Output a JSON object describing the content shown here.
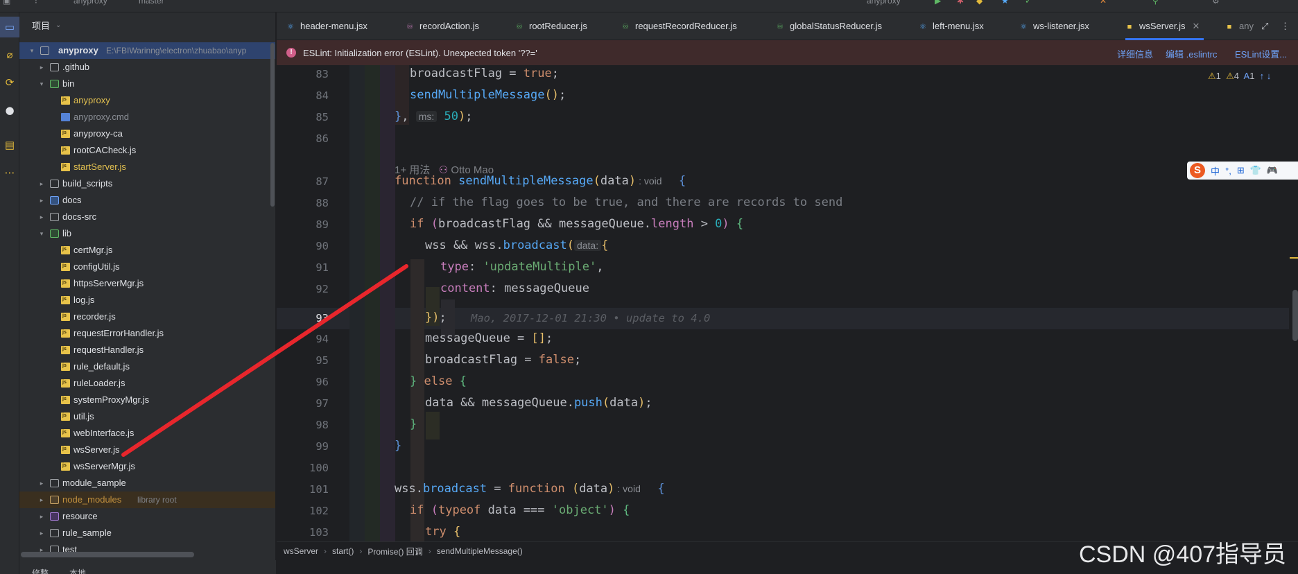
{
  "topbar": {
    "project": "anyproxy",
    "branch": "master",
    "run_config": "anyproxy"
  },
  "activity": {
    "items": [
      "project-icon",
      "commit-icon",
      "pull-requests-icon",
      "github-icon",
      "structure-icon",
      "more-icon"
    ]
  },
  "project_panel": {
    "title": "项目",
    "root": {
      "name": "anyproxy",
      "path": "E:\\FBIWarinng\\electron\\zhuabao\\anyp"
    },
    "tree": [
      {
        "name": ".github",
        "kind": "folder",
        "depth": 1,
        "expanded": false
      },
      {
        "name": "bin",
        "kind": "folder-green",
        "depth": 1,
        "expanded": true
      },
      {
        "name": "anyproxy",
        "kind": "js",
        "depth": 2,
        "color": "yellow"
      },
      {
        "name": "anyproxy.cmd",
        "kind": "cmd",
        "depth": 2,
        "color": "muted"
      },
      {
        "name": "anyproxy-ca",
        "kind": "js",
        "depth": 2
      },
      {
        "name": "rootCACheck.js",
        "kind": "js",
        "depth": 2
      },
      {
        "name": "startServer.js",
        "kind": "js",
        "depth": 2,
        "color": "yellow"
      },
      {
        "name": "build_scripts",
        "kind": "folder",
        "depth": 1,
        "expanded": false
      },
      {
        "name": "docs",
        "kind": "folder-blue",
        "depth": 1,
        "expanded": false
      },
      {
        "name": "docs-src",
        "kind": "folder",
        "depth": 1,
        "expanded": false
      },
      {
        "name": "lib",
        "kind": "folder-green",
        "depth": 1,
        "expanded": true
      },
      {
        "name": "certMgr.js",
        "kind": "js",
        "depth": 2
      },
      {
        "name": "configUtil.js",
        "kind": "js",
        "depth": 2
      },
      {
        "name": "httpsServerMgr.js",
        "kind": "js",
        "depth": 2
      },
      {
        "name": "log.js",
        "kind": "js",
        "depth": 2
      },
      {
        "name": "recorder.js",
        "kind": "js",
        "depth": 2
      },
      {
        "name": "requestErrorHandler.js",
        "kind": "js",
        "depth": 2
      },
      {
        "name": "requestHandler.js",
        "kind": "js",
        "depth": 2
      },
      {
        "name": "rule_default.js",
        "kind": "js",
        "depth": 2
      },
      {
        "name": "ruleLoader.js",
        "kind": "js",
        "depth": 2
      },
      {
        "name": "systemProxyMgr.js",
        "kind": "js",
        "depth": 2
      },
      {
        "name": "util.js",
        "kind": "js",
        "depth": 2
      },
      {
        "name": "webInterface.js",
        "kind": "js",
        "depth": 2
      },
      {
        "name": "wsServer.js",
        "kind": "js",
        "depth": 2
      },
      {
        "name": "wsServerMgr.js",
        "kind": "js",
        "depth": 2
      },
      {
        "name": "module_sample",
        "kind": "folder",
        "depth": 1,
        "expanded": false
      },
      {
        "name": "node_modules",
        "kind": "folder-orange",
        "depth": 1,
        "expanded": false,
        "color": "lib",
        "note": "library root"
      },
      {
        "name": "resource",
        "kind": "folder-purple",
        "depth": 1,
        "expanded": false
      },
      {
        "name": "rule_sample",
        "kind": "folder",
        "depth": 1,
        "expanded": false
      },
      {
        "name": "test",
        "kind": "folder",
        "depth": 1,
        "expanded": false
      }
    ],
    "bottom_tabs": [
      "修整",
      "本地"
    ]
  },
  "tabs": [
    {
      "label": "header-menu.jsx",
      "icon": "react-icon"
    },
    {
      "label": "recordAction.js",
      "icon": "redux-icon"
    },
    {
      "label": "rootReducer.js",
      "icon": "redux-icon"
    },
    {
      "label": "requestRecordReducer.js",
      "icon": "redux-icon"
    },
    {
      "label": "globalStatusReducer.js",
      "icon": "redux-icon"
    },
    {
      "label": "left-menu.jsx",
      "icon": "react-icon"
    },
    {
      "label": "ws-listener.jsx",
      "icon": "react-icon"
    },
    {
      "label": "wsServer.js",
      "icon": "js-icon",
      "active": true
    },
    {
      "label": "any",
      "icon": "js-icon"
    }
  ],
  "banner": {
    "message": "ESLint: Initialization error (ESLint). Unexpected token '??='",
    "links": [
      "详细信息",
      "编辑 .eslintrc",
      "ESLint设置..."
    ]
  },
  "inspections": {
    "warnings_a": "1",
    "warnings_b": "4",
    "typos": "1"
  },
  "code": {
    "current_line": 93,
    "lens": {
      "usages": "1+ 用法",
      "author": "Otto Mao"
    },
    "blame": "Mao, 2017-12-01 21:30 • update to 4.0",
    "hint_ms": "ms:",
    "hint_data": "data:",
    "hint_void": ": void"
  },
  "ime": {
    "items": [
      "中",
      "°,",
      "⊞",
      "👕",
      "🎮"
    ]
  },
  "breadcrumbs": [
    "wsServer",
    "start()",
    "Promise() 回调",
    "sendMultipleMessage()"
  ],
  "watermark": "CSDN @407指导员"
}
